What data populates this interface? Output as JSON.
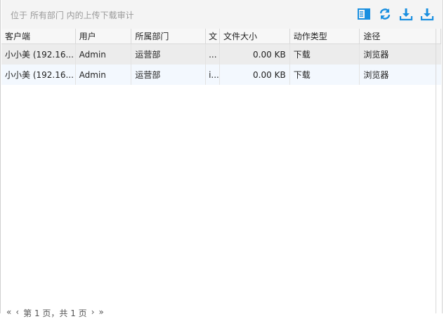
{
  "title": "位于 所有部门 内的上传下载审计",
  "toolbar": {
    "icons": [
      "columns-icon",
      "refresh-icon",
      "download-icon",
      "export-icon"
    ],
    "accent": "#1a8fe0"
  },
  "table": {
    "headers": {
      "client": "客户端",
      "user": "用户",
      "dept": "所属部门",
      "file": "文",
      "size": "文件大小",
      "action": "动作类型",
      "path": "途径"
    },
    "rows": [
      {
        "client": "小小美 (192.16...",
        "user": "Admin",
        "dept": "运营部",
        "file": "...",
        "size": "0.00 KB",
        "action": "下载",
        "path": "浏览器"
      },
      {
        "client": "小小美 (192.16...",
        "user": "Admin",
        "dept": "运营部",
        "file": "i...",
        "size": "0.00 KB",
        "action": "下载",
        "path": "浏览器"
      }
    ]
  },
  "pager": {
    "first": "«",
    "prev": "‹",
    "page_text": "第 1 页，共 1 页",
    "next": "›",
    "last": "»"
  }
}
